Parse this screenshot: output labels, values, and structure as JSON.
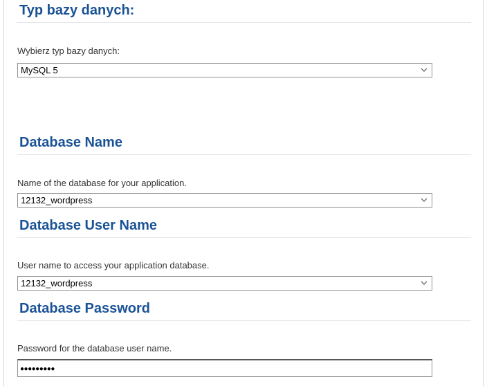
{
  "db_type": {
    "heading": "Typ bazy danych:",
    "label": "Wybierz typ bazy danych:",
    "selected": "MySQL 5"
  },
  "db_name": {
    "heading": "Database Name",
    "label": "Name of the database for your application.",
    "selected": "12132_wordpress"
  },
  "db_user": {
    "heading": "Database User Name",
    "label": "User name to access your application database.",
    "selected": "12132_wordpress"
  },
  "db_password": {
    "heading": "Database Password",
    "label": "Password for the database user name.",
    "masked_value": "●●●●●●●●●"
  },
  "icons": {
    "dropdown": "chevron-down-icon"
  },
  "colors": {
    "heading": "#1a5296",
    "label": "#333333",
    "border": "#8f8f8f"
  }
}
